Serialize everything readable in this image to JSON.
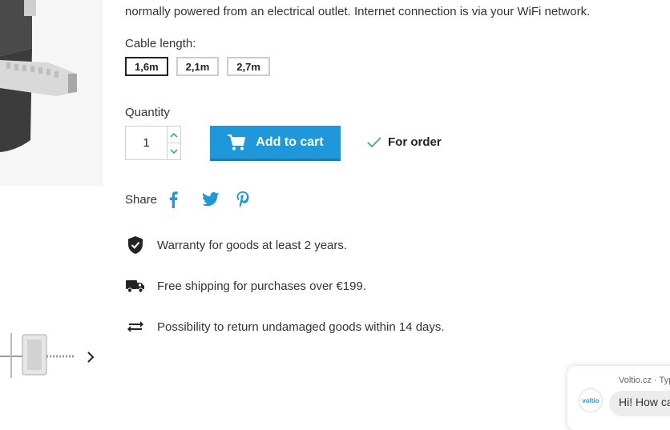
{
  "description": {
    "line": "normally powered from an electrical outlet. Internet connection is via your WiFi network."
  },
  "cable": {
    "label": "Cable length:",
    "options": [
      "1,6m",
      "2,1m",
      "2,7m"
    ],
    "selected": "1,6m"
  },
  "quantity": {
    "label": "Quantity",
    "value": "1"
  },
  "cart": {
    "button_label": "Add to cart",
    "icon": "shopping-cart-icon"
  },
  "availability": {
    "text": "For order",
    "icon": "checkmark-icon",
    "color": "#4cbb6c"
  },
  "share": {
    "label": "Share",
    "networks": [
      "facebook-icon",
      "twitter-icon",
      "pinterest-icon"
    ],
    "color": "#1e98da"
  },
  "benefits": [
    {
      "icon": "shield-check-icon",
      "text": "Warranty for goods at least 2 years."
    },
    {
      "icon": "truck-icon",
      "text": "Free shipping for purchases over €199."
    },
    {
      "icon": "exchange-arrows-icon",
      "text": "Possibility to return undamaged goods within 14 days."
    }
  ],
  "chat": {
    "header": "Voltio.cz · Typ",
    "message": "Hi! How ca",
    "avatar_text": "voltio"
  },
  "colors": {
    "accent": "#1e98da",
    "text": "#232323"
  }
}
